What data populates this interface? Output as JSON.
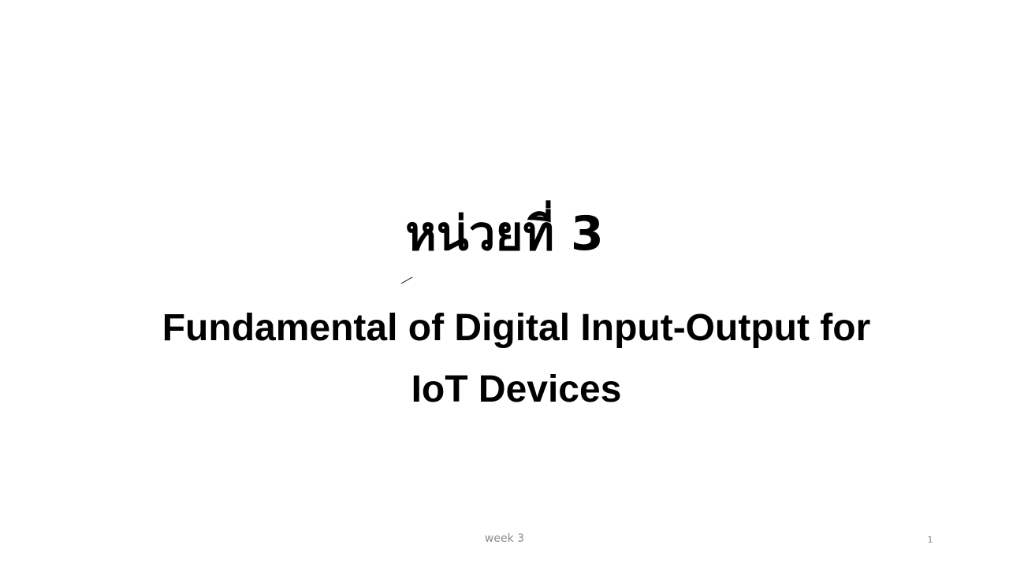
{
  "slide": {
    "title": "หน่วยที่ 3",
    "subtitle_line1": "Fundamental of Digital Input-Output for",
    "subtitle_line2": "IoT Devices",
    "footer": "week 3",
    "slide_number": "1"
  },
  "colors": {
    "background": "#ffffff",
    "text": "#000000",
    "footer_text": "#8a8a8a"
  }
}
